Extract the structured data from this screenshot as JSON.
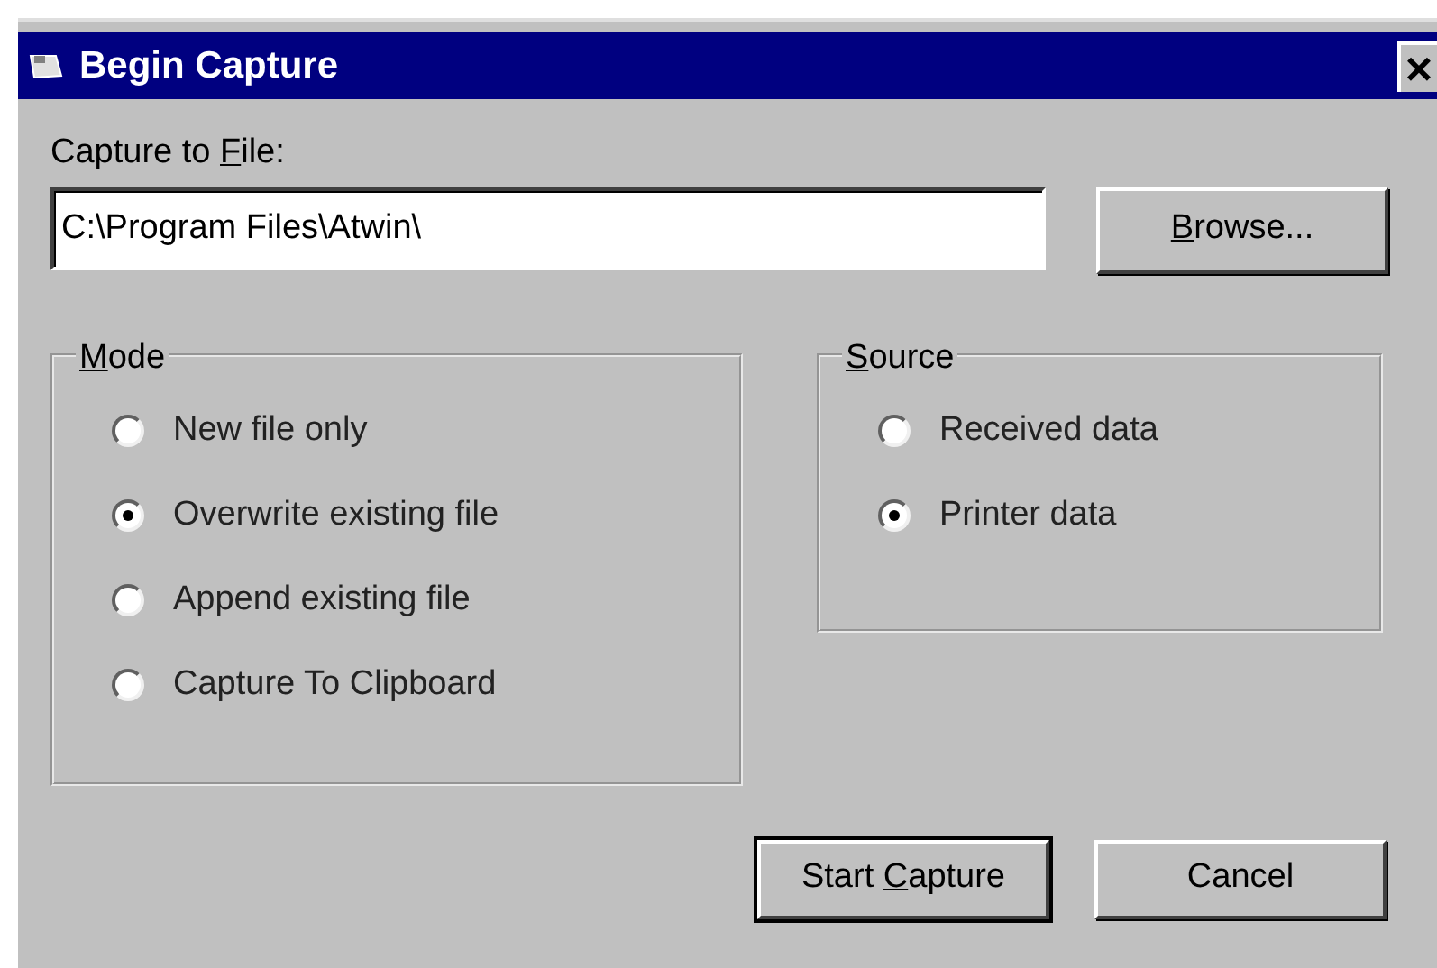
{
  "window": {
    "title": "Begin Capture",
    "close": "×"
  },
  "file": {
    "label": {
      "before": "Capture to ",
      "accel": "F",
      "after": "ile:"
    },
    "value": "C:\\Program Files\\Atwin\\"
  },
  "browse": {
    "accel": "B",
    "after": "rowse..."
  },
  "groups": [
    {
      "legend": {
        "accel": "M",
        "after": "ode"
      },
      "options": [
        {
          "label": "New file only",
          "selected": false
        },
        {
          "label": "Overwrite existing file",
          "selected": true
        },
        {
          "label": "Append existing file",
          "selected": false
        },
        {
          "label": "Capture To Clipboard",
          "selected": false
        }
      ]
    },
    {
      "legend": {
        "accel": "S",
        "after": "ource"
      },
      "options": [
        {
          "label": "Received data",
          "selected": false
        },
        {
          "label": "Printer data",
          "selected": true
        }
      ]
    }
  ],
  "buttons": [
    {
      "text": {
        "before": "Start ",
        "accel": "C",
        "after": "apture"
      },
      "default": true
    },
    {
      "text": {
        "before": "Cancel"
      },
      "default": false
    }
  ]
}
